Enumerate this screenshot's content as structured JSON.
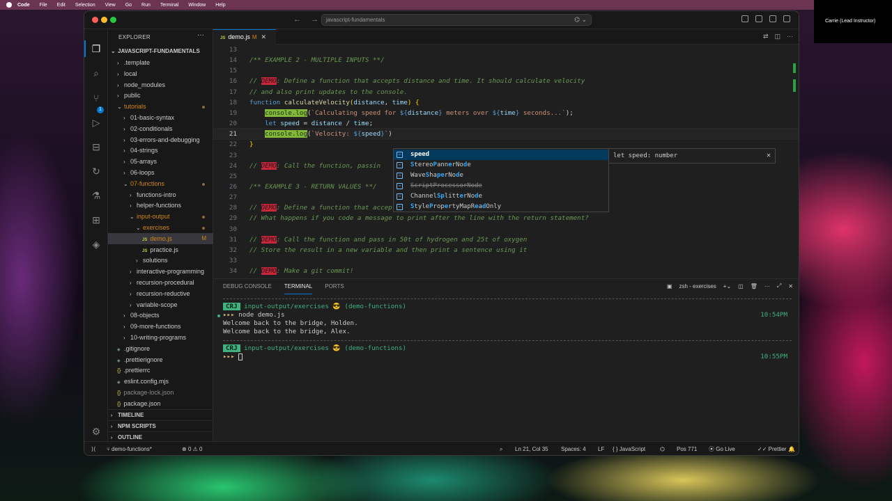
{
  "menubar": {
    "app": "Code",
    "items": [
      "File",
      "Edit",
      "Selection",
      "View",
      "Go",
      "Run",
      "Terminal",
      "Window",
      "Help"
    ]
  },
  "video": {
    "name": "Carrie (Lead Instructor)"
  },
  "titlebar": {
    "search": "javascript-fundamentals"
  },
  "sidebar": {
    "title": "EXPLORER",
    "root": "JAVASCRIPT-FUNDAMENTALS",
    "items": [
      {
        "label": ".template",
        "indent": 1,
        "type": "folder",
        "open": false,
        "style": "plain"
      },
      {
        "label": "local",
        "indent": 1,
        "type": "folder",
        "open": false,
        "style": "plain"
      },
      {
        "label": "node_modules",
        "indent": 1,
        "type": "folder",
        "open": false,
        "style": "plain"
      },
      {
        "label": "public",
        "indent": 1,
        "type": "folder",
        "open": false,
        "style": "plain"
      },
      {
        "label": "tutorials",
        "indent": 1,
        "type": "folder",
        "open": true,
        "style": "orange",
        "dot": true
      },
      {
        "label": "01-basic-syntax",
        "indent": 2,
        "type": "folder",
        "open": false,
        "style": "plain"
      },
      {
        "label": "02-conditionals",
        "indent": 2,
        "type": "folder",
        "open": false,
        "style": "plain"
      },
      {
        "label": "03-errors-and-debugging",
        "indent": 2,
        "type": "folder",
        "open": false,
        "style": "plain"
      },
      {
        "label": "04-strings",
        "indent": 2,
        "type": "folder",
        "open": false,
        "style": "plain"
      },
      {
        "label": "05-arrays",
        "indent": 2,
        "type": "folder",
        "open": false,
        "style": "plain"
      },
      {
        "label": "06-loops",
        "indent": 2,
        "type": "folder",
        "open": false,
        "style": "plain"
      },
      {
        "label": "07-functions",
        "indent": 2,
        "type": "folder",
        "open": true,
        "style": "orange",
        "dot": true
      },
      {
        "label": "functions-intro",
        "indent": 3,
        "type": "folder",
        "open": false,
        "style": "plain"
      },
      {
        "label": "helper-functions",
        "indent": 3,
        "type": "folder",
        "open": false,
        "style": "plain"
      },
      {
        "label": "input-output",
        "indent": 3,
        "type": "folder",
        "open": true,
        "style": "orange",
        "dot": true
      },
      {
        "label": "exercises",
        "indent": 4,
        "type": "folder",
        "open": true,
        "style": "orange",
        "dot": true
      },
      {
        "label": "demo.js",
        "indent": 5,
        "type": "js",
        "style": "orange",
        "selected": true,
        "mtag": "M"
      },
      {
        "label": "practice.js",
        "indent": 5,
        "type": "js",
        "style": "plain"
      },
      {
        "label": "solutions",
        "indent": 4,
        "type": "folder",
        "open": false,
        "style": "plain"
      },
      {
        "label": "interactive-programming",
        "indent": 3,
        "type": "folder",
        "open": false,
        "style": "plain"
      },
      {
        "label": "recursion-procedural",
        "indent": 3,
        "type": "folder",
        "open": false,
        "style": "plain"
      },
      {
        "label": "recursion-reductive",
        "indent": 3,
        "type": "folder",
        "open": false,
        "style": "plain"
      },
      {
        "label": "variable-scope",
        "indent": 3,
        "type": "folder",
        "open": false,
        "style": "plain"
      },
      {
        "label": "08-objects",
        "indent": 2,
        "type": "folder",
        "open": false,
        "style": "plain"
      },
      {
        "label": "09-more-functions",
        "indent": 2,
        "type": "folder",
        "open": false,
        "style": "plain"
      },
      {
        "label": "10-writing-programs",
        "indent": 2,
        "type": "folder",
        "open": false,
        "style": "plain"
      },
      {
        "label": ".gitignore",
        "indent": 1,
        "type": "file",
        "style": "plain"
      },
      {
        "label": ".prettierignore",
        "indent": 1,
        "type": "file",
        "style": "plain"
      },
      {
        "label": ".prettierrc",
        "indent": 1,
        "type": "brace",
        "style": "plain"
      },
      {
        "label": "eslint.config.mjs",
        "indent": 1,
        "type": "file",
        "style": "plain"
      },
      {
        "label": "package-lock.json",
        "indent": 1,
        "type": "brace",
        "style": "dim"
      },
      {
        "label": "package.json",
        "indent": 1,
        "type": "brace",
        "style": "plain"
      }
    ],
    "sections": [
      "TIMELINE",
      "NPM SCRIPTS",
      "OUTLINE"
    ]
  },
  "tab": {
    "label": "demo.js",
    "modified": "M"
  },
  "editor": {
    "lines": [
      {
        "n": "13",
        "html": ""
      },
      {
        "n": "14",
        "html": "<span class='c-comment'>/** EXAMPLE 2 - MULTIPLE INPUTS **/</span>"
      },
      {
        "n": "15",
        "html": ""
      },
      {
        "n": "16",
        "html": "<span class='c-comment'>// </span><span class='c-demo'>DEMO</span><span class='c-comment'>: Define a function that accepts distance and time. It should calculate velocity</span>"
      },
      {
        "n": "17",
        "html": "<span class='c-comment'>// and also print updates to the console.</span>"
      },
      {
        "n": "18",
        "html": "<span class='c-kw'>function</span> <span class='c-fn'>calculateVelocity</span><span class='yellowish'>(</span><span class='c-param'>distance</span><span class='plain'>, </span><span class='c-param'>time</span><span class='yellowish'>)</span> <span class='yellowish'>{</span>"
      },
      {
        "n": "19",
        "html": "    <span class='c-hl'>console.log</span><span class='plain'>(</span><span class='c-str'>`Calculating speed for </span><span class='c-tmpl'>${</span><span class='c-param'>distance</span><span class='c-tmpl'>}</span><span class='c-str'> meters over </span><span class='c-tmpl'>${</span><span class='c-param'>time</span><span class='c-tmpl'>}</span><span class='c-str'> seconds...`</span><span class='plain'>);</span>"
      },
      {
        "n": "20",
        "html": "    <span class='c-kw'>let</span> <span class='c-param'>speed</span> <span class='plain'>= </span><span class='c-param'>distance</span> <span class='plain'>/ </span><span class='c-param'>time</span><span class='plain'>;</span>"
      },
      {
        "n": "21",
        "html": "    <span class='c-hl'>console.log</span><span class='plain'>(</span><span class='c-str'>`Velocity: </span><span class='c-tmpl'>${</span><span class='c-param'>speed</span><span class='c-tmpl'>}</span><span class='c-str'>`</span><span class='plain'>)</span>",
        "current": true
      },
      {
        "n": "22",
        "html": "<span class='yellowish'>}</span>"
      },
      {
        "n": "23",
        "html": ""
      },
      {
        "n": "24",
        "html": "<span class='c-comment'>// </span><span class='c-demo'>DEMO</span><span class='c-comment'>: Call the function, passin</span>"
      },
      {
        "n": "25",
        "html": ""
      },
      {
        "n": "26",
        "html": "<span class='c-comment'>/** EXAMPLE 3 - RETURN VALUES **/</span>"
      },
      {
        "n": "27",
        "html": ""
      },
      {
        "n": "28",
        "html": "<span class='c-comment'>// </span><span class='c-demo'>DEMO</span><span class='c-comment'>: Define a function that accepts amounts of hydrogen and oxygen and returns the total</span>"
      },
      {
        "n": "29",
        "html": "<span class='c-comment'>// What happens if you code a message to print after the line with the return statement?</span>"
      },
      {
        "n": "30",
        "html": ""
      },
      {
        "n": "31",
        "html": "<span class='c-comment'>// </span><span class='c-demo'>DEMO</span><span class='c-comment'>: Call the function and pass in 50t of hydrogen and 25t of oxygen</span>"
      },
      {
        "n": "32",
        "html": "<span class='c-comment'>// Store the result in a new variable and then print a sentence using it</span>"
      },
      {
        "n": "33",
        "html": ""
      },
      {
        "n": "34",
        "html": "<span class='c-comment'>// </span><span class='c-demo'>DEMO</span><span class='c-comment'>: Make a git commit!</span>"
      }
    ]
  },
  "suggest": {
    "items": [
      {
        "html": "<b>speed</b>",
        "sel": true
      },
      {
        "html": "<b>S</b>tereo<b>P</b>ann<b>e</b>rNo<b>d</b>e"
      },
      {
        "html": "Wave<b>S</b>ha<b>pe</b>rNo<b>d</b>e"
      },
      {
        "html": "ScriptProcessorNode",
        "strike": true
      },
      {
        "html": "Channel<b>Sp</b>litt<b>e</b>rNo<b>d</b>e"
      },
      {
        "html": "<b>S</b>tyle<b>P</b>rop<b>e</b>rtyMapR<b>e</b>a<b>d</b>Only"
      }
    ],
    "detail": "let speed: number"
  },
  "panel": {
    "tabs": [
      "DEBUG CONSOLE",
      "TERMINAL",
      "PORTS"
    ],
    "active_tab": "TERMINAL",
    "shell": "zsh - exercises",
    "badge": "CRJ",
    "path": "input-output/exercises",
    "emoji": "😎",
    "branch": "(demo-functions)",
    "prompt": "▸▸▸",
    "cmd": "node demo.js",
    "out1": "Welcome back to the bridge, Holden.",
    "out2": "Welcome back to the bridge, Alex.",
    "time1": "10:54PM",
    "time2": "10:55PM"
  },
  "status": {
    "branch": "demo-functions*",
    "errors": "0",
    "warnings": "0",
    "position": "Ln 21, Col 35",
    "spaces": "Spaces: 4",
    "eol": "LF",
    "lang": "JavaScript",
    "pos": "Pos 771",
    "golive": "Go Live",
    "prettier": "Prettier"
  }
}
